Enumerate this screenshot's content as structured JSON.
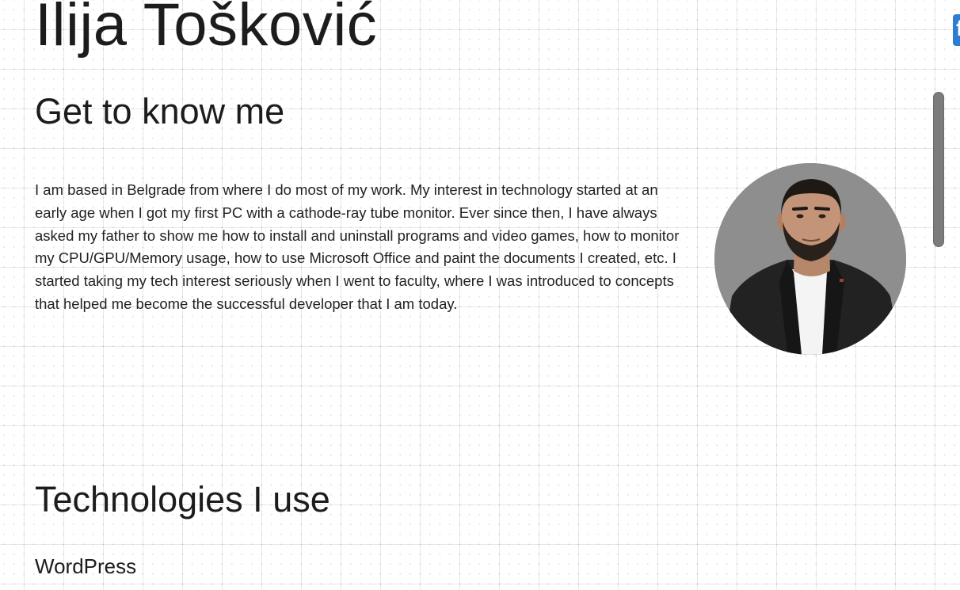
{
  "site": {
    "title": "Ilija Tošković"
  },
  "about": {
    "heading": "Get to know me",
    "paragraph": "I am based in Belgrade from where I do most of my work. My interest in technology started at an early age when I got my first PC with a cathode-ray tube monitor. Ever since then, I have always asked my father to show me how to install and uninstall programs and video games, how to monitor my CPU/GPU/Memory usage, how to use Microsoft Office and paint the documents I created, etc. I started taking my tech interest seriously when I went to faculty, where I was introduced to concepts that helped me become the successful developer that I am today."
  },
  "technologies": {
    "heading": "Technologies I use",
    "items": [
      "WordPress"
    ]
  },
  "social": {
    "facebook_icon": "facebook-icon"
  },
  "colors": {
    "background": "#ffffff",
    "text": "#1c1c1c",
    "facebook_blue": "#2d7dd2",
    "scrollbar": "#7c7c7c"
  }
}
